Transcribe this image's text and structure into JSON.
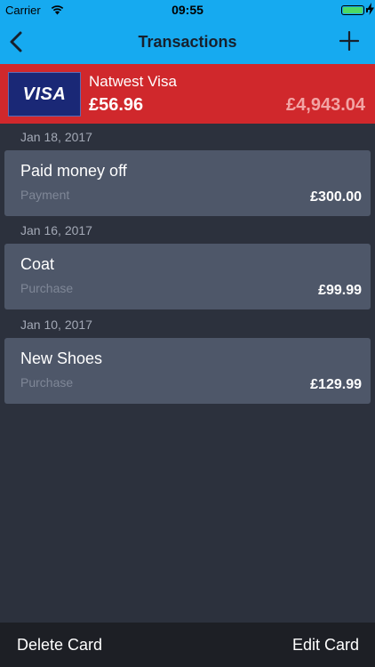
{
  "status_bar": {
    "carrier": "Carrier",
    "time": "09:55",
    "battery_level": 1.0
  },
  "nav": {
    "title": "Transactions",
    "back_icon": "chevron-left-icon",
    "add_icon": "plus-icon"
  },
  "card": {
    "logo_text": "VISA",
    "name": "Natwest Visa",
    "balance": "£56.96",
    "limit": "£4,943.04",
    "color": "#d0282c"
  },
  "transactions": [
    {
      "date": "Jan 18, 2017",
      "name": "Paid money off",
      "type": "Payment",
      "amount": "£300.00"
    },
    {
      "date": "Jan 16, 2017",
      "name": "Coat",
      "type": "Purchase",
      "amount": "£99.99"
    },
    {
      "date": "Jan 10, 2017",
      "name": "New Shoes",
      "type": "Purchase",
      "amount": "£129.99"
    }
  ],
  "toolbar": {
    "delete_label": "Delete Card",
    "edit_label": "Edit Card"
  },
  "colors": {
    "accent": "#16aaf0",
    "background": "#2c313d",
    "row": "#4e5769"
  }
}
